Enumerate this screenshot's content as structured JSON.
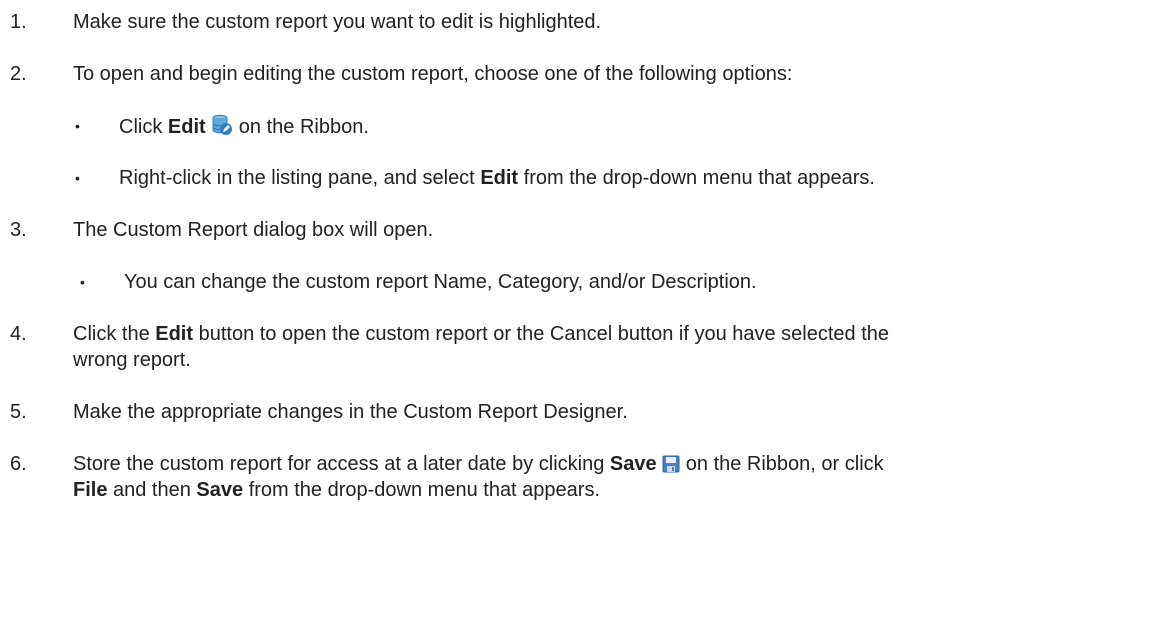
{
  "steps": [
    {
      "number": "1.",
      "text": "Make sure the custom report you want to edit is highlighted."
    },
    {
      "number": "2.",
      "text": "To open and begin editing the custom report, choose one of the following options:",
      "bullets": [
        {
          "pre": "Click ",
          "bold": "Edit",
          "icon": "database-edit-icon",
          "post": " on the Ribbon."
        },
        {
          "pre": "Right-click in the listing pane, and select ",
          "bold": "Edit",
          "post": " from the drop-down menu that appears."
        }
      ]
    },
    {
      "number": "3.",
      "text": "The Custom Report dialog box will open.",
      "bullets": [
        {
          "text": "You can change the custom report Name, Category, and/or Description."
        }
      ]
    },
    {
      "number": "4.",
      "pre": "Click the ",
      "bold": "Edit",
      "post": " button to open the custom report or the Cancel button if you have selected the",
      "continuation": "wrong report."
    },
    {
      "number": "5.",
      "text": "Make the appropriate changes in the Custom Report Designer."
    },
    {
      "number": "6.",
      "pre": "Store the custom report for access at a later date by clicking ",
      "bold": "Save",
      "icon": "save-icon",
      "post": " on the Ribbon, or click",
      "cont_bold1": "File",
      "cont_mid": " and then ",
      "cont_bold2": "Save",
      "cont_post": " from the drop-down menu that appears."
    }
  ],
  "bullet_char": "•",
  "colors": {
    "text": "#222222",
    "edit_icon_blue": "#2f7fc1",
    "edit_icon_light": "#8ec6ec",
    "save_icon_blue": "#4a7fc0"
  }
}
